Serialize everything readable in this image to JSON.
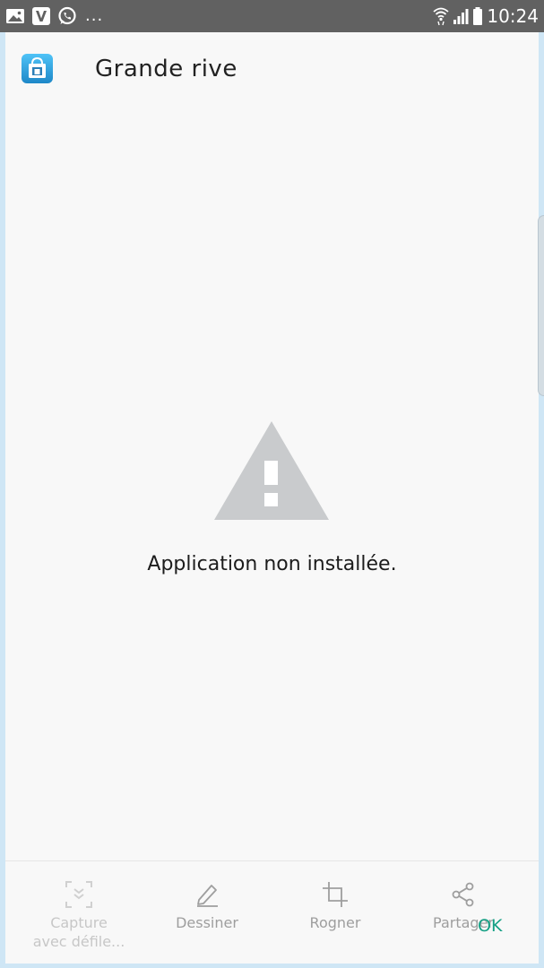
{
  "status_bar": {
    "icons_left": [
      "image-icon",
      "viber-icon",
      "whatsapp-icon"
    ],
    "more": "...",
    "icons_right": [
      "wifi-icon",
      "signal-icon",
      "battery-icon"
    ],
    "time": "10:24"
  },
  "header": {
    "app_icon": "store-bag-icon",
    "title": "Grande rive"
  },
  "main": {
    "warning_icon": "warning-triangle-icon",
    "message": "Application non installée."
  },
  "toolbar": {
    "items": [
      {
        "label_line1": "Capture",
        "label_line2": "avec défile...",
        "icon": "scroll-capture-icon"
      },
      {
        "label": "Dessiner",
        "icon": "pencil-icon"
      },
      {
        "label": "Rogner",
        "icon": "crop-icon"
      },
      {
        "label": "Partager",
        "icon": "share-icon"
      }
    ],
    "ok_label": "OK"
  },
  "colors": {
    "status_bar": "#616161",
    "accent": "#15a085",
    "warning_gray": "#c9cbcd",
    "frame": "#cfe6f5"
  }
}
